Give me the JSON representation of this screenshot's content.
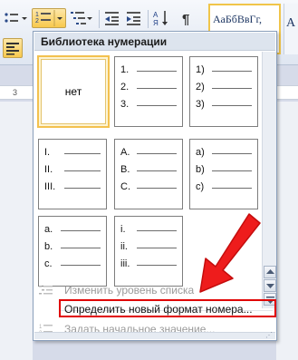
{
  "ribbon": {
    "style_sample": "АаБбВвГг,",
    "style_next_sample": "А"
  },
  "ruler": {
    "mark": "3"
  },
  "dropdown": {
    "title": "Библиотека нумерации",
    "tiles": [
      {
        "none_label": "нет",
        "labels": [],
        "selected": true
      },
      {
        "labels": [
          "1.",
          "2.",
          "3."
        ]
      },
      {
        "labels": [
          "1)",
          "2)",
          "3)"
        ]
      },
      {
        "labels": [
          "I.",
          "II.",
          "III."
        ]
      },
      {
        "labels": [
          "A.",
          "B.",
          "C."
        ]
      },
      {
        "labels": [
          "a)",
          "b)",
          "c)"
        ]
      },
      {
        "labels": [
          "a.",
          "b.",
          "c."
        ]
      },
      {
        "labels": [
          "i.",
          "ii.",
          "iii."
        ]
      }
    ],
    "menu": {
      "change_level": "Изменить уровень списка",
      "define_format": "Определить новый формат номера...",
      "set_value": "Задать начальное значение..."
    }
  },
  "colors": {
    "highlight_box": "#e00000",
    "arrow": "#ee1c1c",
    "selected_tile": "#f3c14f"
  },
  "icons": [
    "bullets-icon",
    "numbering-icon",
    "multilevel-list-icon",
    "decrease-indent-icon",
    "increase-indent-icon",
    "sort-icon",
    "pilcrow-icon",
    "align-left-icon",
    "change-level-icon",
    "set-value-icon",
    "scroll-up-icon",
    "scroll-down-icon",
    "scroll-more-icon"
  ]
}
